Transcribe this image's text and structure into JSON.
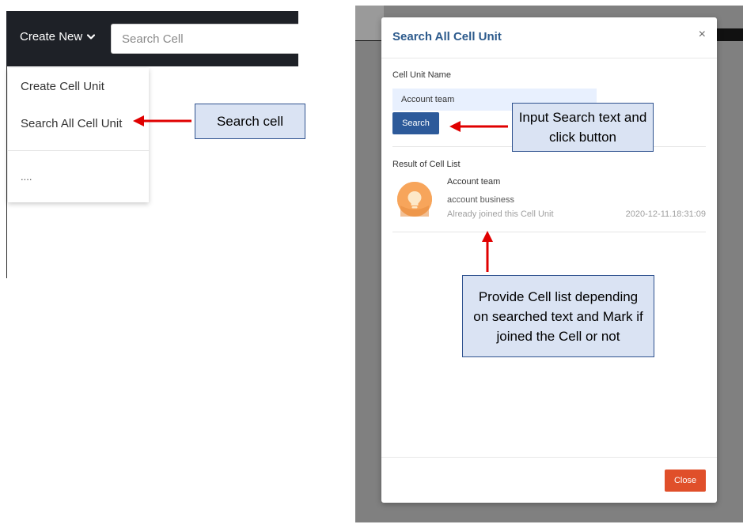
{
  "left_panel": {
    "create_new_label": "Create New",
    "search_placeholder": "Search Cell",
    "dropdown": {
      "items": [
        {
          "label": "Create Cell Unit"
        },
        {
          "label": "Search All Cell Unit"
        },
        {
          "label": "...."
        }
      ]
    },
    "callout": "Search cell"
  },
  "modal": {
    "title": "Search All Cell Unit",
    "close_icon": "×",
    "name_label": "Cell Unit Name",
    "name_value": "Account team",
    "search_button": "Search",
    "result_label": "Result of Cell List",
    "results": [
      {
        "name": "Account team",
        "description": "account business",
        "status": "Already joined this Cell Unit",
        "timestamp": "2020-12-11.18:31:09",
        "avatar_icon": "lightbulb-icon",
        "avatar_color": "#f7a55b"
      }
    ],
    "close_button": "Close"
  },
  "callouts": {
    "input_search": "Input Search text and click button",
    "provide_list": "Provide Cell list depending on searched text and Mark if joined the Cell or not"
  },
  "colors": {
    "topbar": "#1e2127",
    "modal_title": "#2c5a8c",
    "search_button": "#2d5a9a",
    "close_button": "#e04f2a",
    "callout_fill": "#dae3f3",
    "callout_border": "#2f528f",
    "arrow": "#e00000"
  }
}
